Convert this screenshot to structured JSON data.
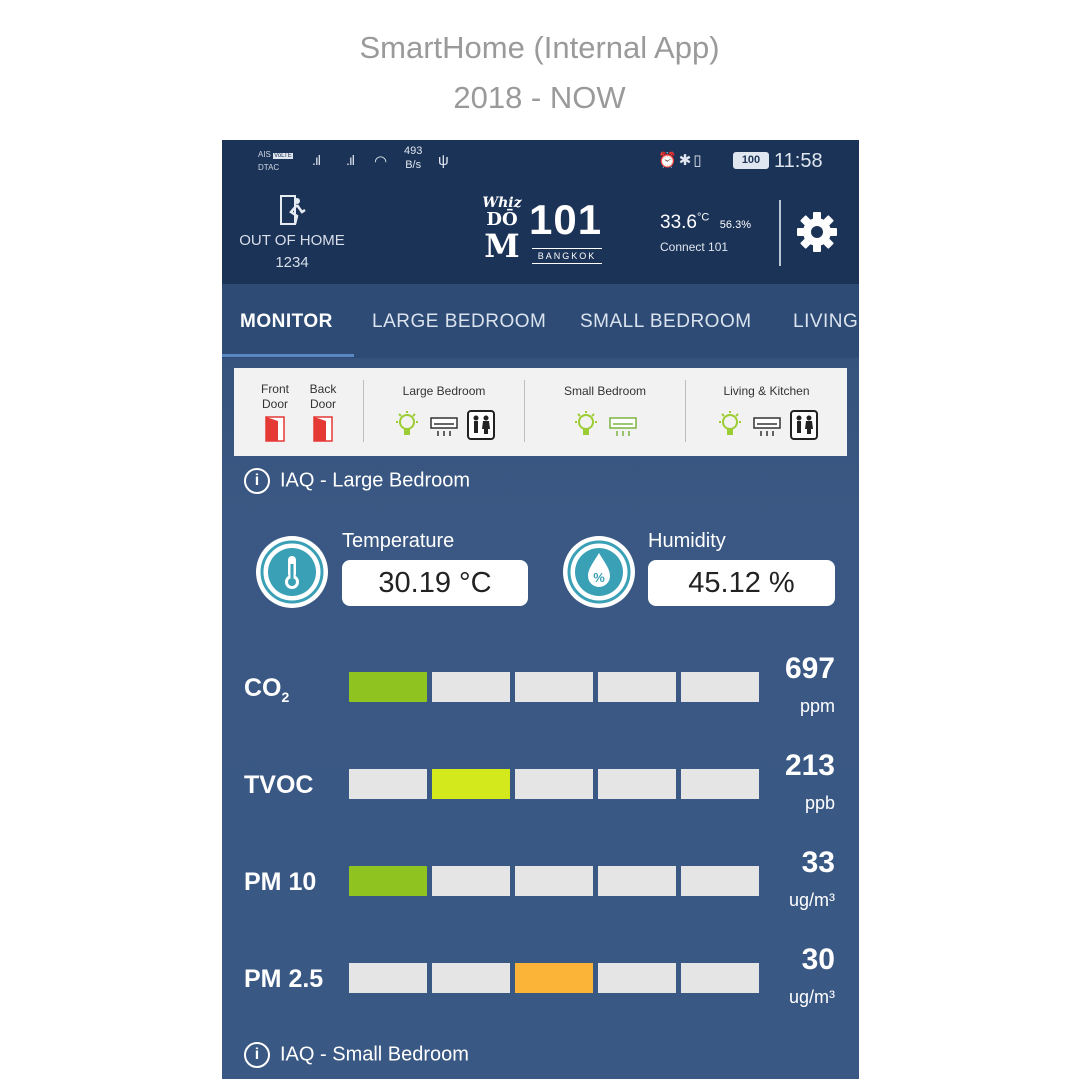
{
  "caption": {
    "title": "SmartHome (Internal App)",
    "period": "2018 - NOW"
  },
  "status_bar": {
    "carrier_1": "AIS",
    "carrier_1_badge": "VoLTE",
    "carrier_2": "DTAC",
    "speed_value": "493",
    "speed_unit": "B/s",
    "battery": "100",
    "time": "11:58"
  },
  "app_bar": {
    "mode_label": "OUT OF HOME",
    "mode_code": "1234",
    "logo_top": "Whiz",
    "logo_mid": "DŌ",
    "logo_m": "M",
    "logo_number": "101",
    "logo_city": "BANGKOK",
    "outdoor_temp": "33.6",
    "outdoor_temp_unit": "°C",
    "outdoor_humidity": "56.3%",
    "connection": "Connect 101"
  },
  "tabs": [
    {
      "label": "MONITOR",
      "active": true
    },
    {
      "label": "LARGE BEDROOM",
      "active": false
    },
    {
      "label": "SMALL BEDROOM",
      "active": false
    },
    {
      "label": "LIVING",
      "active": false
    }
  ],
  "devices": {
    "front_door": "Front Door",
    "back_door": "Back Door",
    "rooms": [
      {
        "title": "Large Bedroom",
        "icons": [
          "bulb-icon",
          "aircon-icon",
          "restroom-icon"
        ]
      },
      {
        "title": "Small Bedroom",
        "icons": [
          "bulb-icon",
          "aircon-icon"
        ]
      },
      {
        "title": "Living & Kitchen",
        "icons": [
          "bulb-icon",
          "aircon-icon",
          "restroom-icon"
        ]
      }
    ],
    "colors": {
      "door": "#e53935",
      "bulb": "#9ccc33",
      "aircon_active": "#7cb342"
    }
  },
  "iaq_large": {
    "section_title": "IAQ - Large Bedroom",
    "temperature_label": "Temperature",
    "temperature_value": "30.19 °C",
    "humidity_label": "Humidity",
    "humidity_value": "45.12 %",
    "metrics": [
      {
        "name": "CO",
        "sub": "2",
        "value": "697",
        "unit": "ppm",
        "level": 1,
        "color": "#8fc31f"
      },
      {
        "name": "TVOC",
        "sub": "",
        "value": "213",
        "unit": "ppb",
        "level": 2,
        "color": "#d4e91c"
      },
      {
        "name": "PM 10",
        "sub": "",
        "value": "33",
        "unit": "ug/m³",
        "level": 1,
        "color": "#8fc31f"
      },
      {
        "name": "PM 2.5",
        "sub": "",
        "value": "30",
        "unit": "ug/m³",
        "level": 3,
        "color": "#fbb437"
      }
    ]
  },
  "iaq_small": {
    "section_title": "IAQ - Small Bedroom"
  },
  "theme": {
    "header": "#1c3358",
    "background": "#3a5883",
    "icon_teal": "#3aa0b6"
  }
}
